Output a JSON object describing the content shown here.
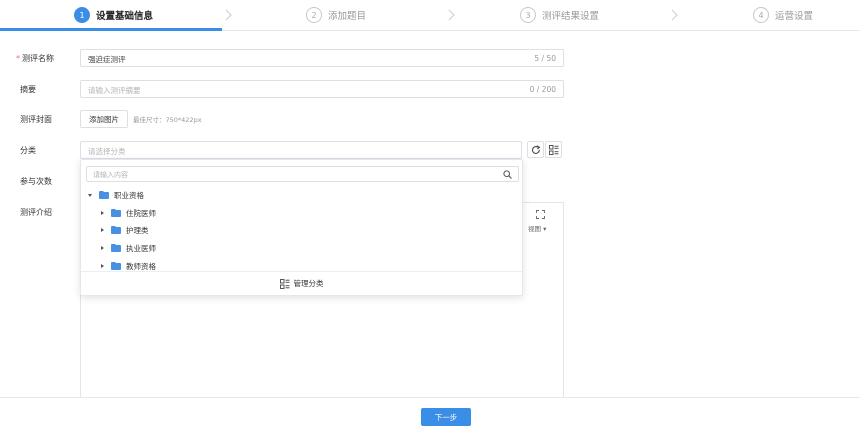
{
  "steps": [
    {
      "num": "1",
      "label": "设置基础信息"
    },
    {
      "num": "2",
      "label": "添加题目"
    },
    {
      "num": "3",
      "label": "测评结果设置"
    },
    {
      "num": "4",
      "label": "运营设置"
    }
  ],
  "active_step": 1,
  "form": {
    "name": {
      "label": "测评名称",
      "value": "强迫症测评",
      "count": "5 / 50"
    },
    "summary": {
      "label": "摘要",
      "placeholder": "请输入测评摘要",
      "count": "0 / 200"
    },
    "cover": {
      "label": "测评封面",
      "button": "添加图片",
      "hint": "最佳尺寸：750*422px"
    },
    "category": {
      "label": "分类",
      "placeholder": "请选择分类"
    },
    "participants": {
      "label": "参与次数"
    },
    "intro": {
      "label": "测评介绍",
      "view_label": "视图 ▾"
    }
  },
  "dropdown": {
    "search_placeholder": "请输入内容",
    "tree": [
      {
        "label": "职业资格",
        "expanded": true,
        "level": 0
      },
      {
        "label": "住院医师",
        "expanded": false,
        "level": 1
      },
      {
        "label": "护理类",
        "expanded": false,
        "level": 1
      },
      {
        "label": "执业医师",
        "expanded": false,
        "level": 1
      },
      {
        "label": "教师资格",
        "expanded": false,
        "level": 1
      }
    ],
    "footer": "管理分类"
  },
  "next_button": "下一步",
  "colors": {
    "accent": "#3a8ee6",
    "required": "#f56c6c",
    "folder": "#4a90e2"
  }
}
